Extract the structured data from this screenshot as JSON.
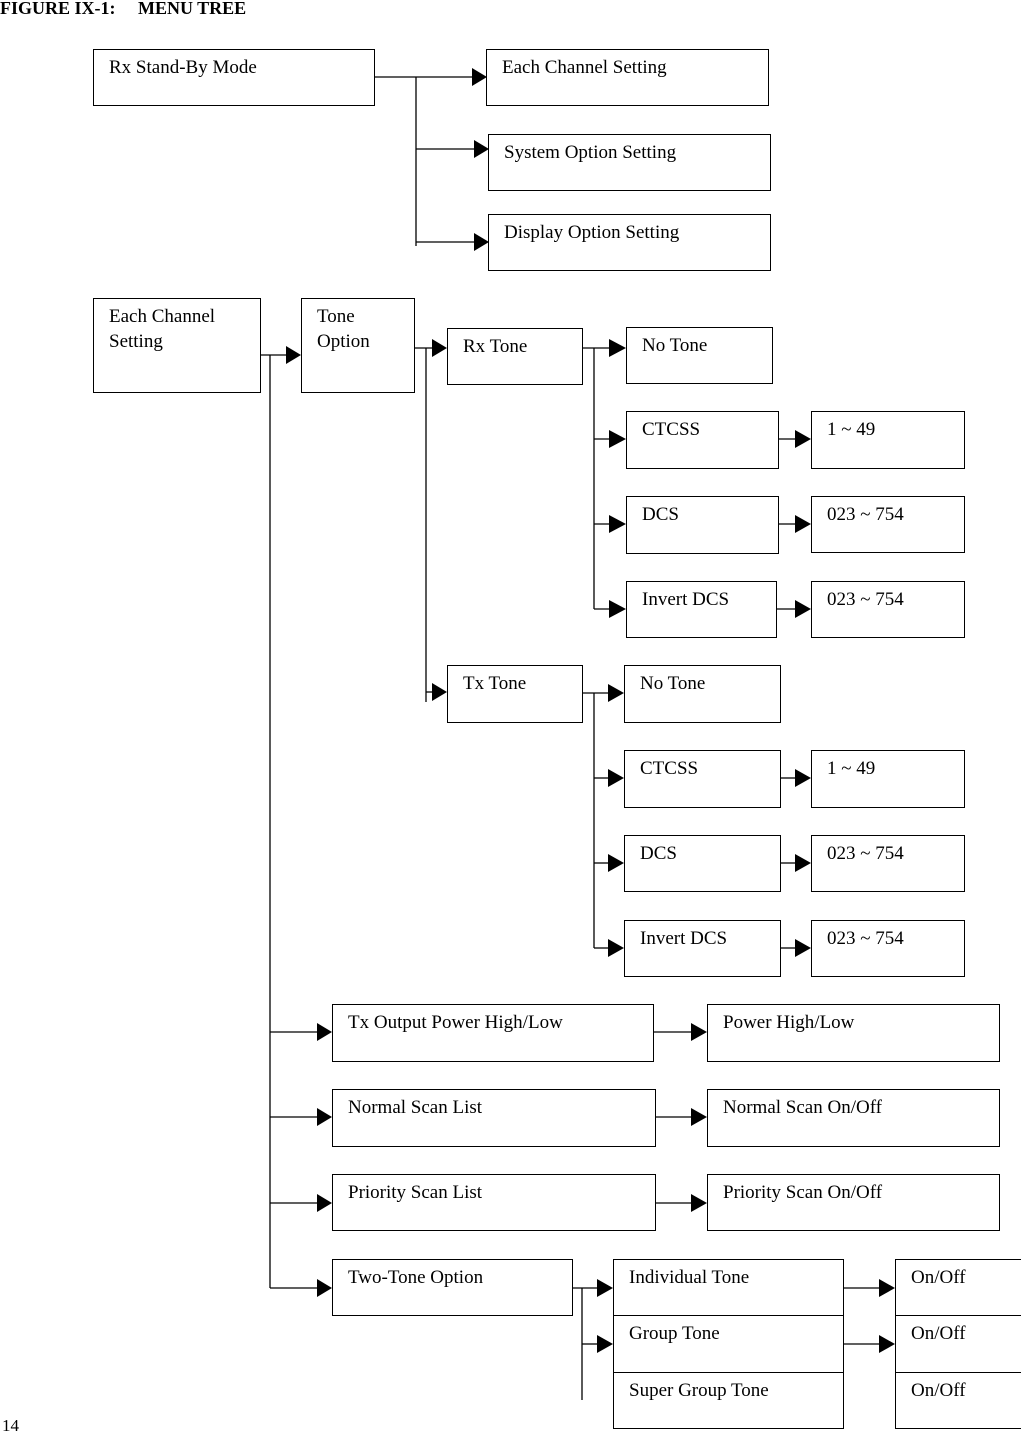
{
  "figure_title": "FIGURE IX-1:     MENU TREE",
  "page_number": "14",
  "top_menu": {
    "root": "Rx Stand-By Mode",
    "children": [
      "Each Channel Setting",
      "System Option Setting",
      "Display Option Setting"
    ]
  },
  "channel_menu": {
    "root": "Each Channel Setting",
    "tone_option": {
      "label": "Tone Option",
      "rx_tone": {
        "label": "Rx Tone",
        "options": [
          {
            "label": "No Tone",
            "value": null
          },
          {
            "label": "CTCSS",
            "value": "1 ~ 49"
          },
          {
            "label": "DCS",
            "value": "023 ~ 754"
          },
          {
            "label": "Invert DCS",
            "value": "023 ~ 754"
          }
        ]
      },
      "tx_tone": {
        "label": "Tx Tone",
        "options": [
          {
            "label": "No Tone",
            "value": null
          },
          {
            "label": "CTCSS",
            "value": "1 ~ 49"
          },
          {
            "label": "DCS",
            "value": "023 ~ 754"
          },
          {
            "label": "Invert DCS",
            "value": "023 ~ 754"
          }
        ]
      }
    },
    "items": [
      {
        "label": "Tx Output Power High/Low",
        "value": "Power High/Low"
      },
      {
        "label": "Normal Scan List",
        "value": "Normal Scan On/Off"
      },
      {
        "label": "Priority Scan List",
        "value": "Priority Scan On/Off"
      }
    ],
    "two_tone": {
      "label": "Two-Tone Option",
      "options": [
        {
          "label": "Individual Tone",
          "value": "On/Off"
        },
        {
          "label": "Group Tone",
          "value": "On/Off"
        },
        {
          "label": "Super Group Tone",
          "value": "On/Off"
        }
      ]
    }
  }
}
